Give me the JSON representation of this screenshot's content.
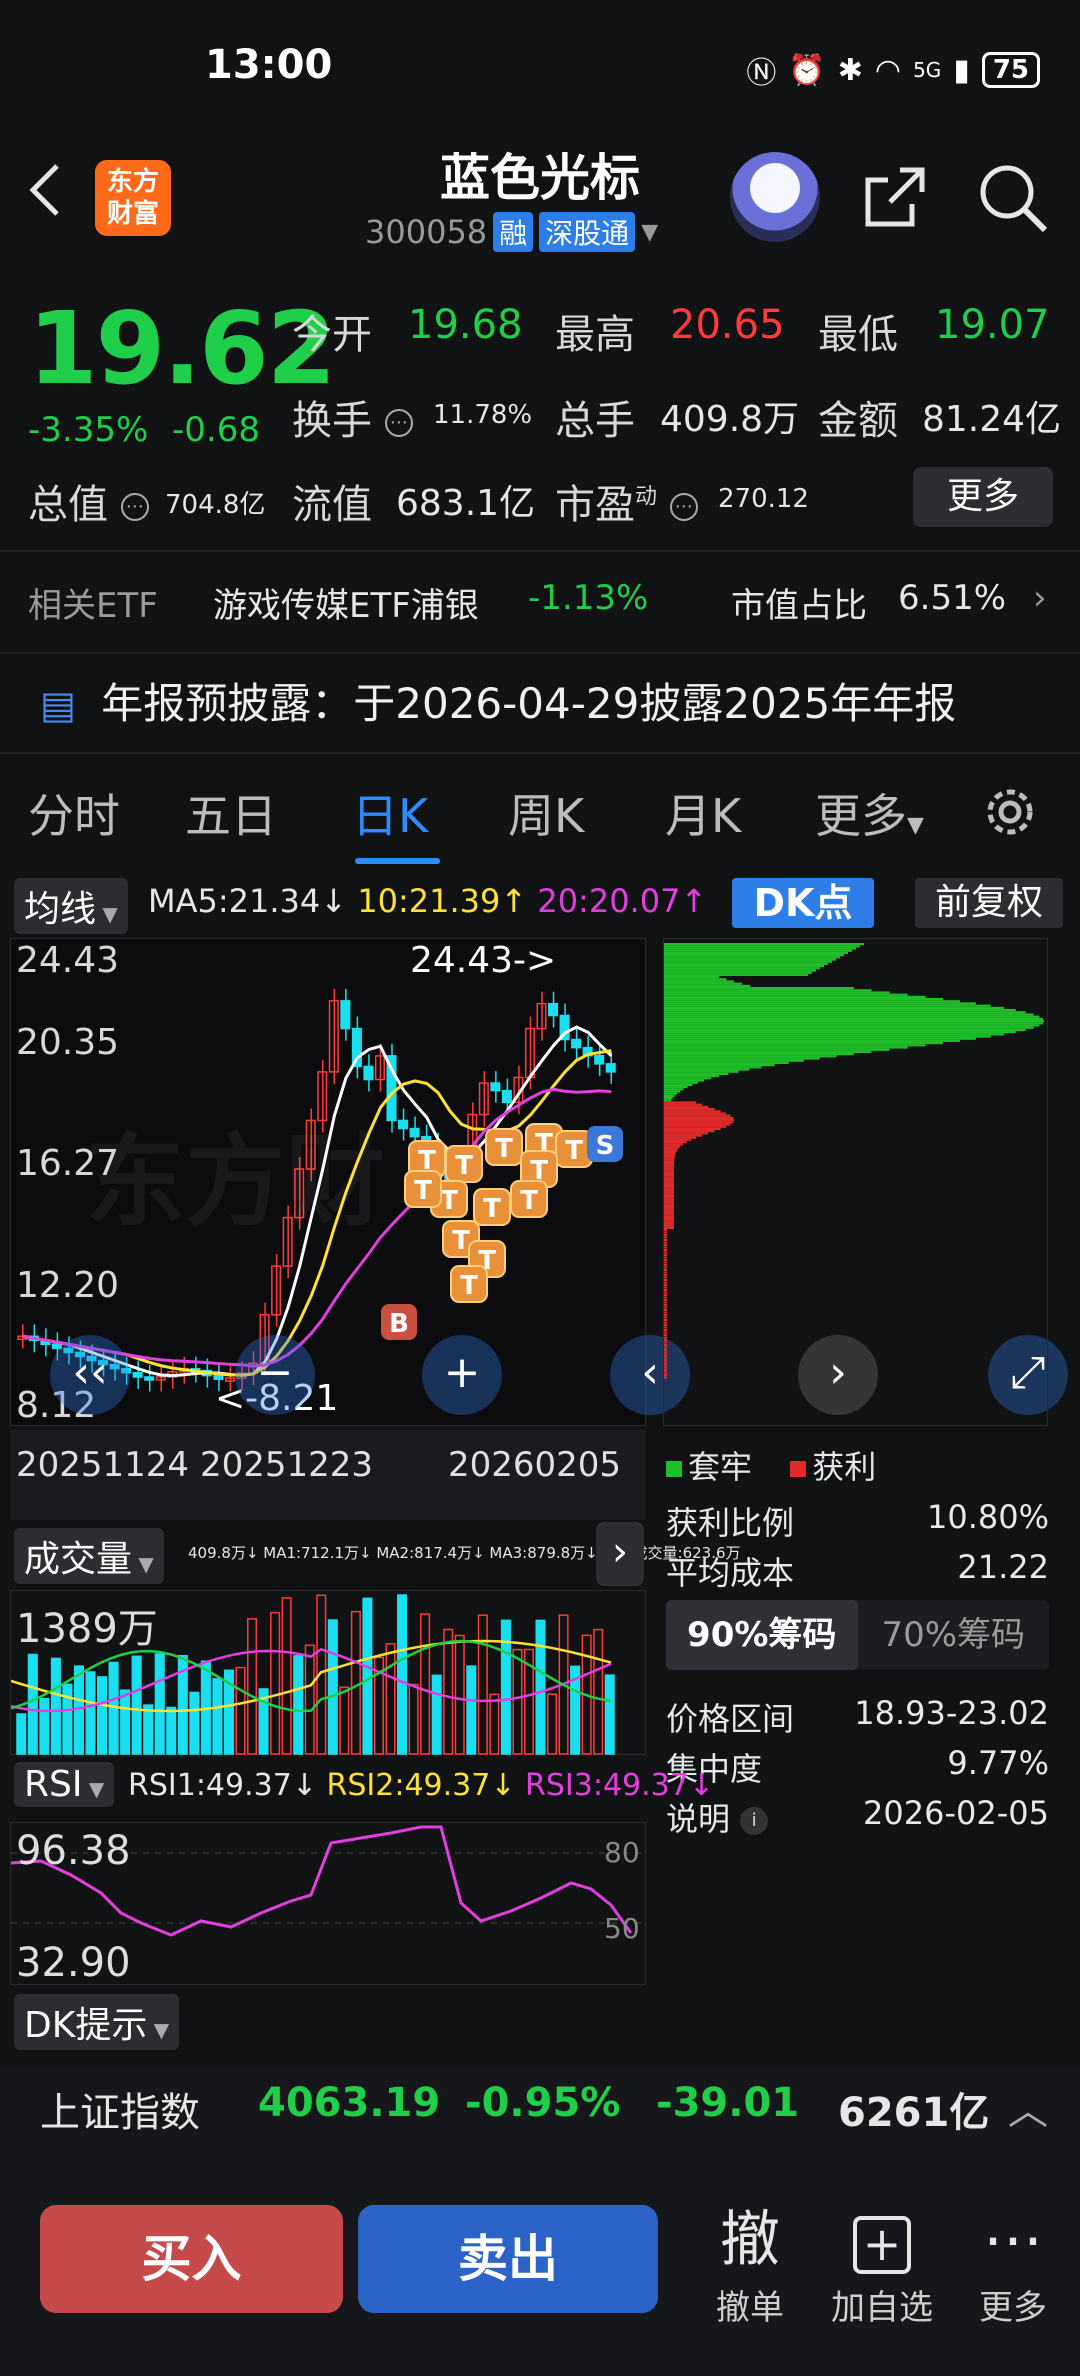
{
  "status": {
    "time": "13:00",
    "battery": "75",
    "network": "5G"
  },
  "header": {
    "logo_line1": "东方",
    "logo_line2": "财富",
    "name": "蓝色光标",
    "code": "300058",
    "tag1": "融",
    "tag2": "深股通"
  },
  "quote": {
    "price": "19.62",
    "change_pct": "-3.35%",
    "change_abs": "-0.68",
    "open_label": "今开",
    "open": "19.68",
    "high_label": "最高",
    "high": "20.65",
    "low_label": "最低",
    "low": "19.07",
    "turnover_label": "换手",
    "turnover": "11.78%",
    "volume_label": "总手",
    "volume": "409.8万",
    "amount_label": "金额",
    "amount": "81.24亿",
    "mktcap_label": "总值",
    "mktcap": "704.8亿",
    "float_label": "流值",
    "float_cap": "683.1亿",
    "pe_label": "市盈",
    "pe_sup": "动",
    "pe": "270.12",
    "more": "更多"
  },
  "etf": {
    "label": "相关ETF",
    "name": "游戏传媒ETF浦银",
    "change": "-1.13%",
    "share_label": "市值占比",
    "share": "6.51%"
  },
  "report": {
    "text": "年报预披露：于2026-04-29披露2025年年报"
  },
  "tabs": [
    "分时",
    "五日",
    "日K",
    "周K",
    "月K",
    "更多"
  ],
  "chart": {
    "ma_dropdown": "均线",
    "ma5": "MA5:21.34",
    "ma10": "10:21.39",
    "ma20": "20:20.07",
    "dk_button": "DK点",
    "adjust_button": "前复权",
    "y_labels": [
      "24.43",
      "20.35",
      "16.27",
      "12.20",
      "8.12"
    ],
    "max_label": "24.43->",
    "min_label": "<-8.21",
    "dates": [
      "20251124",
      "20251223",
      "20260205"
    ],
    "watermark": "东方财",
    "vol_dropdown": "成交量",
    "vol_legend": "409.8万↓ MA1:712.1万↓ MA2:817.4万↓ MA3:879.8万↓ 虚拟成交量:623.6万",
    "vol_max": "1389万",
    "rsi_dropdown": "RSI",
    "rsi1": "RSI1:49.37",
    "rsi2": "RSI2:49.37",
    "rsi3": "RSI3:49.37",
    "rsi_top": "96.38",
    "rsi_bottom": "32.90",
    "rsi_80": "80",
    "rsi_50": "50",
    "dk_tip": "DK提示",
    "colors": {
      "up": "#ff3b3b",
      "down": "#19e0f0",
      "ma5": "#ffffff",
      "ma10": "#ffe135",
      "ma20": "#e23ee0"
    }
  },
  "chip": {
    "legend_trapped": "套牢",
    "legend_profit": "获利",
    "profit_ratio_label": "获利比例",
    "profit_ratio": "10.80%",
    "avg_cost_label": "平均成本",
    "avg_cost": "21.22",
    "tab90": "90%筹码",
    "tab70": "70%筹码",
    "range_label": "价格区间",
    "range": "18.93-23.02",
    "concentration_label": "集中度",
    "concentration": "9.77%",
    "note_label": "说明",
    "note": "2026-02-05"
  },
  "index": {
    "name": "上证指数",
    "value": "4063.19",
    "pct": "-0.95%",
    "change": "-39.01",
    "amount": "6261亿"
  },
  "trade": {
    "buy": "买入",
    "sell": "卖出",
    "cancel_icon_text": "撤",
    "cancel": "撤单",
    "watch": "加自选",
    "more": "更多"
  }
}
